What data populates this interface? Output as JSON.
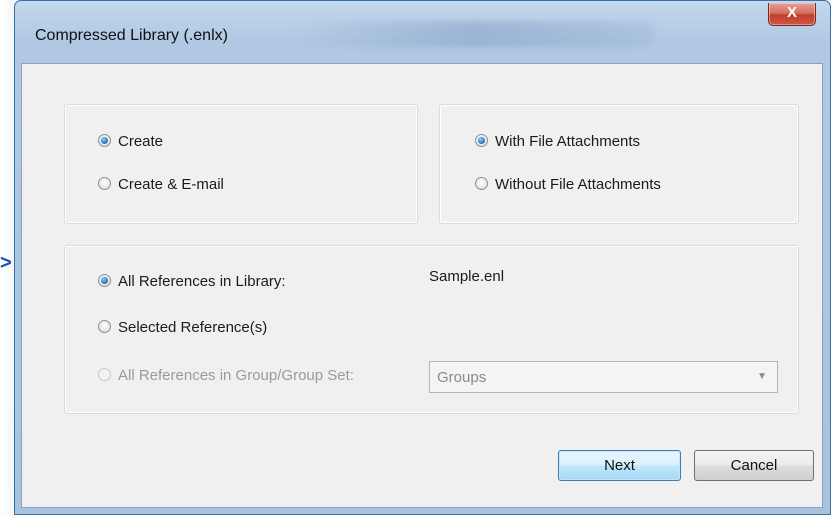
{
  "window": {
    "title": "Compressed Library (.enlx)",
    "close_label": "X"
  },
  "left_arrow": ">",
  "action_group": {
    "options": [
      {
        "label": "Create",
        "checked": true
      },
      {
        "label": "Create & E-mail",
        "checked": false
      }
    ]
  },
  "attachment_group": {
    "options": [
      {
        "label": "With File Attachments",
        "checked": true
      },
      {
        "label": "Without File Attachments",
        "checked": false
      }
    ]
  },
  "references_group": {
    "all_refs_label": "All References in Library:",
    "library_name": "Sample.enl",
    "selected_refs_label": "Selected Reference(s)",
    "group_refs_label": "All References in Group/Group Set:",
    "group_dropdown_value": "Groups"
  },
  "buttons": {
    "next": "Next",
    "cancel": "Cancel"
  }
}
